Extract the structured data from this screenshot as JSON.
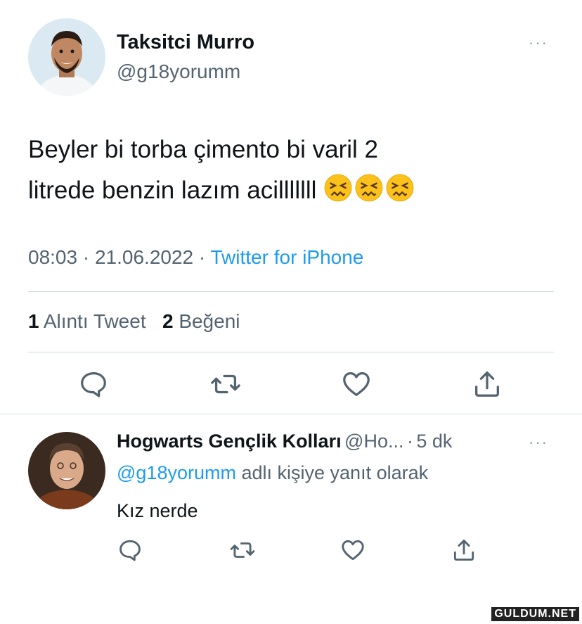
{
  "tweet": {
    "author_name": "Taksitci Murro",
    "author_handle": "@g18yorumm",
    "more_label": "···",
    "text_line1": "Beyler bi torba çimento bi varil 2",
    "text_line2": "litrede benzin lazım acilllllll",
    "emojis": [
      "confounded-face",
      "confounded-face",
      "confounded-face"
    ],
    "time": "08:03",
    "date": "21.06.2022",
    "separator": "·",
    "source": "Twitter for iPhone",
    "quote_count": "1",
    "quote_label": "Alıntı Tweet",
    "like_count": "2",
    "like_label": "Beğeni",
    "actions": [
      "reply-icon",
      "retweet-icon",
      "like-icon",
      "share-icon"
    ]
  },
  "reply": {
    "author_name": "Hogwarts Gençlik Kolları",
    "author_handle": "@Ho...",
    "separator": "·",
    "time_ago": "5 dk",
    "more_label": "···",
    "reply_to_handle": "@g18yorumm",
    "reply_to_suffix": "adlı kişiye yanıt olarak",
    "text": "Kız nerde",
    "actions": [
      "reply-icon",
      "retweet-icon",
      "like-icon",
      "share-icon"
    ]
  },
  "watermark": "GULDUM.NET",
  "colors": {
    "accent": "#1d9bf0",
    "muted": "#536471",
    "divider": "#cfd9de",
    "emoji": "#fcc21b"
  }
}
